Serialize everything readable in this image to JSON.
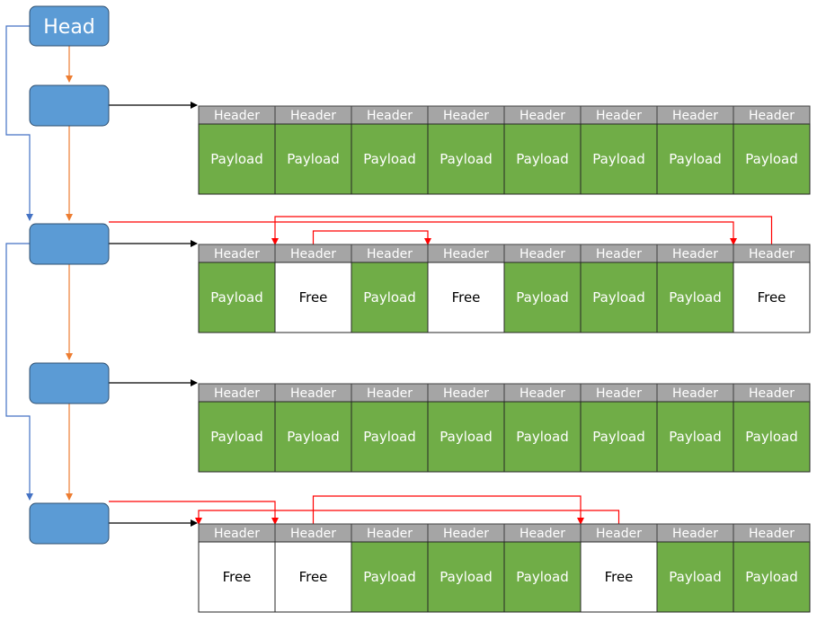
{
  "head_label": "Head",
  "labels": {
    "header": "Header",
    "payload": "Payload",
    "free": "Free"
  },
  "colors": {
    "node": "#5b9bd5",
    "payload": "#70ad47",
    "header": "#a5a5a5",
    "free": "#ffffff",
    "next_link": "#ed7d31",
    "skip_link": "#4472c4",
    "free_list": "#ff0000"
  },
  "blocks": [
    {
      "cells": [
        "payload",
        "payload",
        "payload",
        "payload",
        "payload",
        "payload",
        "payload",
        "payload"
      ],
      "free_list": []
    },
    {
      "cells": [
        "payload",
        "free",
        "payload",
        "free",
        "payload",
        "payload",
        "payload",
        "free"
      ],
      "free_list": [
        8,
        2,
        4
      ]
    },
    {
      "cells": [
        "payload",
        "payload",
        "payload",
        "payload",
        "payload",
        "payload",
        "payload",
        "payload"
      ],
      "free_list": []
    },
    {
      "cells": [
        "free",
        "free",
        "payload",
        "payload",
        "payload",
        "free",
        "payload",
        "payload"
      ],
      "free_list": [
        2,
        6,
        1
      ]
    }
  ]
}
